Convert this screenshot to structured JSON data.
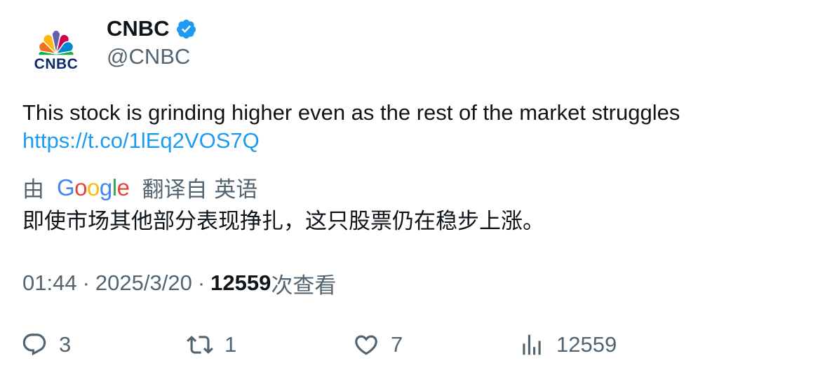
{
  "author": {
    "display_name": "CNBC",
    "handle": "@CNBC",
    "avatar_logo_text": "CNBC",
    "verified_icon": "verified-badge-icon",
    "verified_color": "#1d9bf0"
  },
  "tweet": {
    "text": "This stock is grinding higher even as the rest of the market struggles",
    "link": "https://t.co/1lEq2VOS7Q"
  },
  "translation": {
    "prefix": "由",
    "provider_logo_letters": [
      "G",
      "o",
      "o",
      "g",
      "l",
      "e"
    ],
    "provider_logo_colors": [
      "#4285f4",
      "#ea4335",
      "#fbbc05",
      "#4285f4",
      "#34a853",
      "#ea4335"
    ],
    "suffix": "翻译自 英语",
    "translated_text": "即使市场其他部分表现挣扎，这只股票仍在稳步上涨。"
  },
  "meta": {
    "time": "01:44",
    "date": "2025/3/20",
    "separator": "·",
    "views_count": "12559",
    "views_label": "次查看"
  },
  "actions": [
    {
      "name": "reply",
      "icon": "reply-icon",
      "count": "3"
    },
    {
      "name": "retweet",
      "icon": "retweet-icon",
      "count": "1"
    },
    {
      "name": "like",
      "icon": "like-icon",
      "count": "7"
    },
    {
      "name": "views",
      "icon": "analytics-icon",
      "count": "12559"
    }
  ],
  "colors": {
    "text_primary": "#0f1419",
    "text_secondary": "#536471",
    "link": "#1d9bf0"
  }
}
